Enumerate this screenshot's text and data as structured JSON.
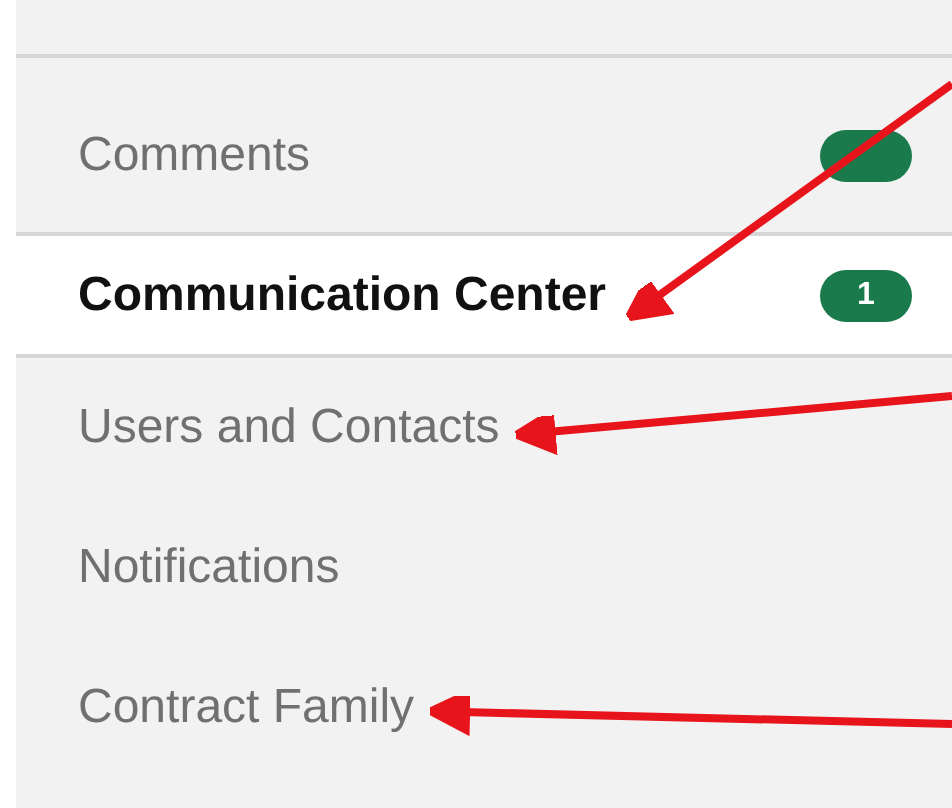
{
  "menu_items": [
    {
      "label": "Comments",
      "selected": false,
      "badge": true,
      "arrow": false
    },
    {
      "label": "Communication Center",
      "selected": true,
      "badge": true,
      "count": "1",
      "arrow": true
    },
    {
      "label": "Users and Contacts",
      "selected": false,
      "badge": false,
      "arrow": true
    },
    {
      "label": "Notifications",
      "selected": false,
      "badge": false,
      "arrow": false
    },
    {
      "label": "Contract Family",
      "selected": false,
      "badge": false,
      "arrow": true
    }
  ]
}
